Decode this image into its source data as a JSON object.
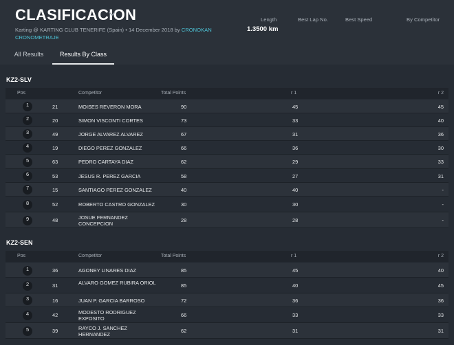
{
  "header": {
    "title": "CLASIFICACION",
    "subtitle_prefix": "Karting @ KARTING CLUB TENERIFE (Spain) • 14 December 2018 by ",
    "subtitle_link": "CRONOKAN CRONOMETRAJE",
    "stats": {
      "length_label": "Length",
      "length_value": "1.3500 km",
      "best_lap_label": "Best Lap No.",
      "best_speed_label": "Best Speed",
      "by_competitor_label": "By Competitor"
    }
  },
  "tabs": [
    {
      "label": "All Results",
      "active": false
    },
    {
      "label": "Results By Class",
      "active": true
    }
  ],
  "columns": {
    "pos": "Pos",
    "competitor": "Competitor",
    "total_points": "Total Points",
    "r1": "r 1",
    "r2": "r 2"
  },
  "classes": [
    {
      "name": "KZ2-SLV",
      "rows": [
        {
          "pos": "1",
          "num": "21",
          "name": "MOISES REVERON MORA",
          "pts": "90",
          "r1": "45",
          "r2": "45"
        },
        {
          "pos": "2",
          "num": "20",
          "name": "SIMON VISCONTI CORTES",
          "pts": "73",
          "r1": "33",
          "r2": "40"
        },
        {
          "pos": "3",
          "num": "49",
          "name": "JORGE ALVAREZ ALVAREZ",
          "pts": "67",
          "r1": "31",
          "r2": "36"
        },
        {
          "pos": "4",
          "num": "19",
          "name": "DIEGO PEREZ GONZALEZ",
          "pts": "66",
          "r1": "36",
          "r2": "30"
        },
        {
          "pos": "5",
          "num": "63",
          "name": "PEDRO CARTAYA DIAZ",
          "pts": "62",
          "r1": "29",
          "r2": "33"
        },
        {
          "pos": "6",
          "num": "53",
          "name": "JESUS R. PEREZ GARCIA",
          "pts": "58",
          "r1": "27",
          "r2": "31"
        },
        {
          "pos": "7",
          "num": "15",
          "name": "SANTIAGO PEREZ GONZALEZ",
          "pts": "40",
          "r1": "40",
          "r2": "-"
        },
        {
          "pos": "8",
          "num": "52",
          "name": "ROBERTO CASTRO GONZALEZ",
          "pts": "30",
          "r1": "30",
          "r2": "-"
        },
        {
          "pos": "9",
          "num": "48",
          "name": "JOSUE FERNANDEZ CONCEPCION",
          "pts": "28",
          "r1": "28",
          "r2": "-"
        }
      ]
    },
    {
      "name": "KZ2-SEN",
      "rows": [
        {
          "pos": "1",
          "num": "36",
          "name": "AGONEY LINARES DIAZ",
          "pts": "85",
          "r1": "45",
          "r2": "40"
        },
        {
          "pos": "2",
          "num": "31",
          "name": "ALVARO GOMEZ RUBIRA ORIOL",
          "pts": "85",
          "r1": "40",
          "r2": "45"
        },
        {
          "pos": "3",
          "num": "16",
          "name": "JUAN P. GARCIA BARROSO",
          "pts": "72",
          "r1": "36",
          "r2": "36"
        },
        {
          "pos": "4",
          "num": "42",
          "name": "MODESTO RODRIGUEZ EXPOSITO",
          "pts": "66",
          "r1": "33",
          "r2": "33"
        },
        {
          "pos": "5",
          "num": "39",
          "name": "RAYCO J. SANCHEZ HERNANDEZ",
          "pts": "62",
          "r1": "31",
          "r2": "31"
        }
      ]
    }
  ],
  "colors": {
    "accent_link": "#4dc3d6",
    "background": "#262c34",
    "row_alt": "#2c323a",
    "badge": "#181c21"
  },
  "icons": {
    "title_dropdown": "chevron-down-icon"
  }
}
